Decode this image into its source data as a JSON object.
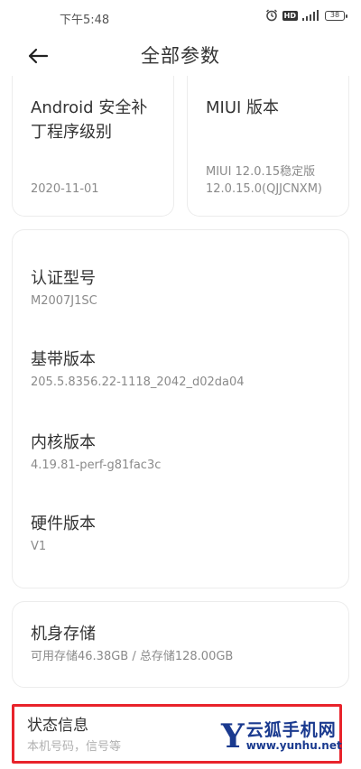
{
  "status_bar": {
    "time": "下午5:48",
    "icons": [
      "alarm-icon",
      "hd-icon",
      "signal-icon",
      "battery-icon"
    ],
    "hd_label": "HD",
    "battery": "38"
  },
  "header": {
    "title": "全部参数",
    "back_icon": "back-arrow-icon"
  },
  "cards": {
    "android_patch": {
      "label": "Android 安全补丁程序级别",
      "value": "2020-11-01"
    },
    "miui": {
      "label": "MIUI 版本",
      "value_line1": "MIUI 12.0.15稳定版",
      "value_line2": "12.0.15.0(QJJCNXM)"
    },
    "model": {
      "label": "认证型号",
      "value": "M2007J1SC"
    },
    "baseband": {
      "label": "基带版本",
      "value": "205.5.8356.22-1118_2042_d02da04"
    },
    "kernel": {
      "label": "内核版本",
      "value": "4.19.81-perf-g81fac3c"
    },
    "hardware": {
      "label": "硬件版本",
      "value": "V1"
    },
    "storage": {
      "label": "机身存储",
      "value": "可用存储46.38GB / 总存储128.00GB"
    },
    "status": {
      "label": "状态信息",
      "value": "本机号码，信号等"
    }
  },
  "watermark": {
    "letter": "Y",
    "name": "云狐手机网",
    "url": "www.yunhu.net"
  },
  "colors": {
    "highlight_border": "#e8232b",
    "watermark": "#1a3a8f"
  }
}
